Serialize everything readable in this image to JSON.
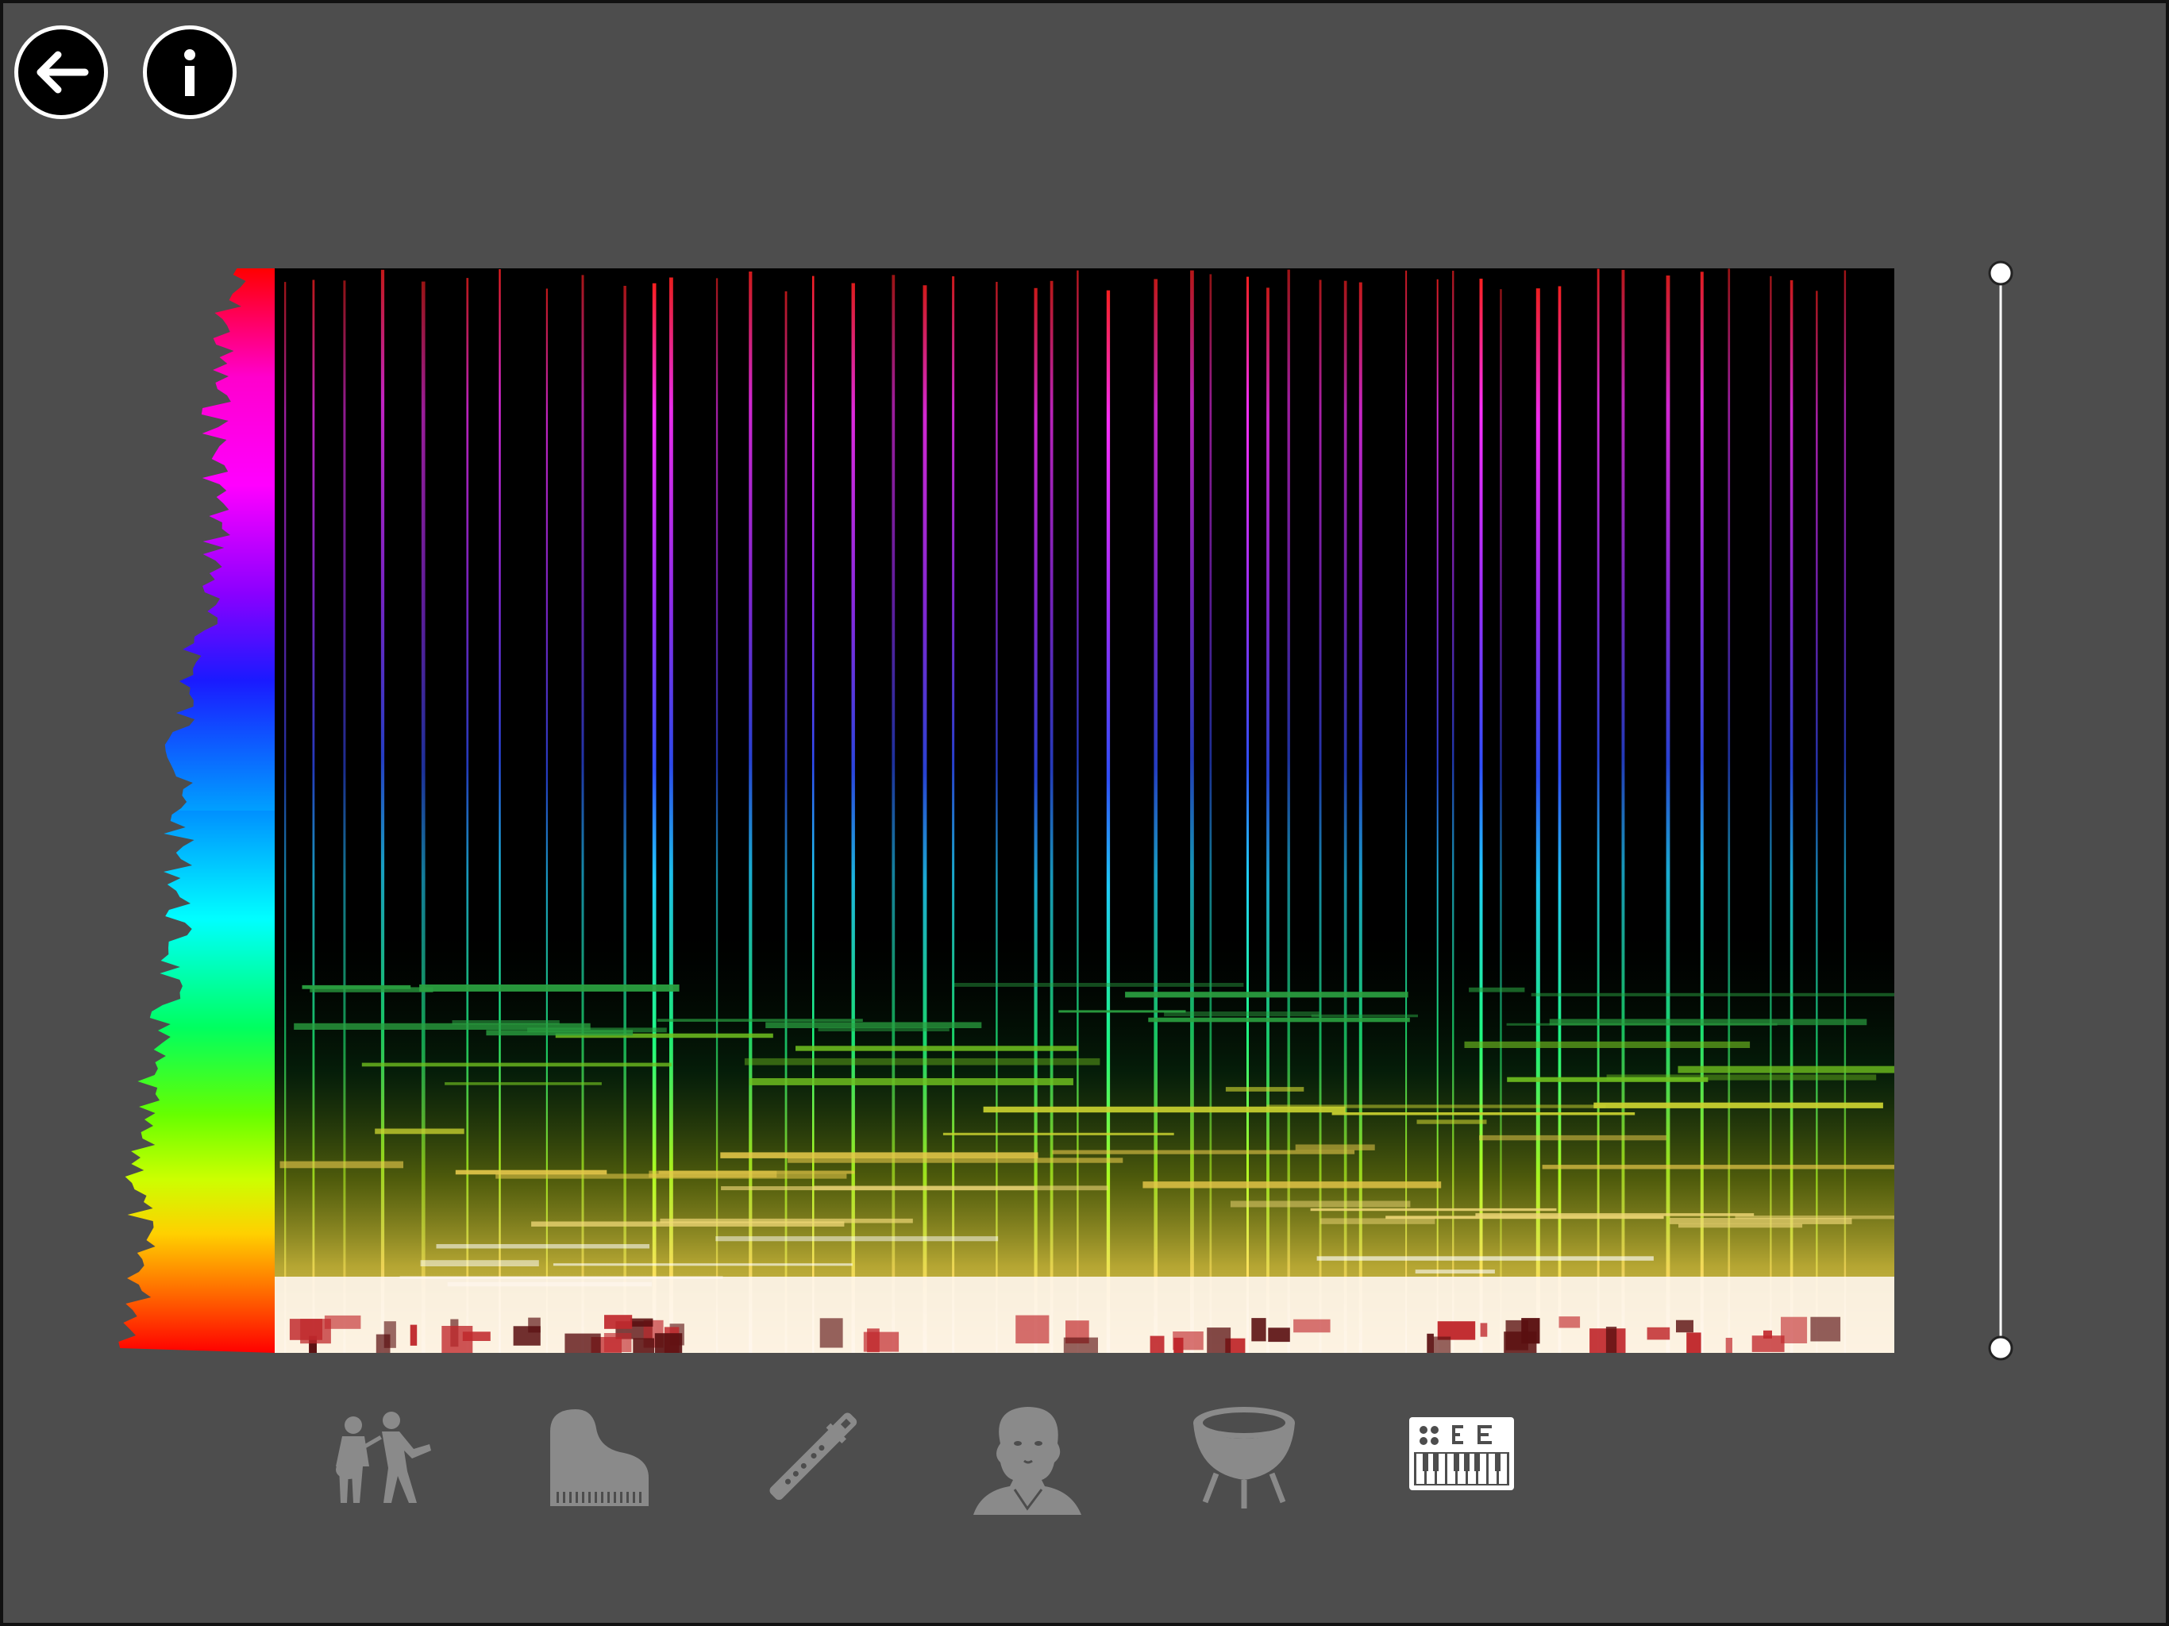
{
  "navigation": {
    "back_icon": "arrow-left-icon",
    "info_icon": "info-icon"
  },
  "instruments": [
    {
      "id": "band",
      "icon": "band-musicians-icon",
      "active": false
    },
    {
      "id": "piano",
      "icon": "grand-piano-icon",
      "active": false
    },
    {
      "id": "flute",
      "icon": "flute-icon",
      "active": false
    },
    {
      "id": "classical",
      "icon": "composer-portrait-icon",
      "active": false
    },
    {
      "id": "drum",
      "icon": "drum-icon",
      "active": false
    },
    {
      "id": "synth",
      "icon": "synthesizer-icon",
      "active": true
    }
  ],
  "colors": {
    "background": "#4d4d4d",
    "inactive_icon": "#8a8a8a",
    "active_icon": "#ffffff",
    "slider_line": "#ffffff"
  },
  "range_slider": {
    "low": 0,
    "high": 1
  }
}
